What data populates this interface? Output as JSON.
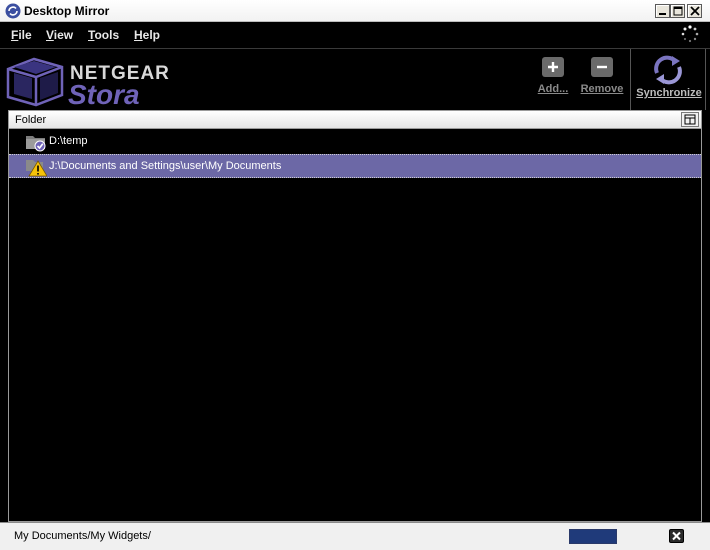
{
  "window": {
    "title": "Desktop Mirror"
  },
  "menu": {
    "file": {
      "key": "F",
      "rest": "ile"
    },
    "view": {
      "key": "V",
      "rest": "iew"
    },
    "tools": {
      "key": "T",
      "rest": "ools"
    },
    "help": {
      "key": "H",
      "rest": "elp"
    }
  },
  "logo": {
    "brand": "NETGEAR",
    "product": "Stora"
  },
  "toolbar": {
    "add_label": "Add...",
    "remove_label": "Remove",
    "sync_label": "Synchronize"
  },
  "list": {
    "column_header": "Folder",
    "rows": [
      {
        "path": "D:\\temp",
        "status_icon": "folder-check-icon"
      },
      {
        "path": "J:\\Documents and Settings\\user\\My Documents",
        "status_icon": "warning-icon",
        "selected": true
      }
    ]
  },
  "status": {
    "text": "My Documents/My Widgets/",
    "progress": 1.0
  },
  "colors": {
    "selection": "#6c68a6",
    "brand_purple": "#6f63b8",
    "progress": "#1f3a7a"
  }
}
